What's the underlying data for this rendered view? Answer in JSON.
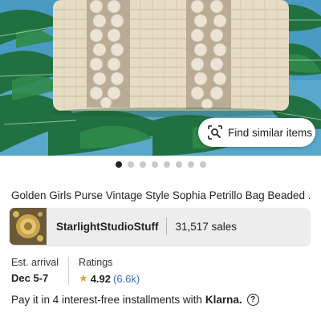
{
  "listing": {
    "image_alt": "Beaded wicker purse on palm leaf fabric",
    "find_similar_label": "Find similar items",
    "carousel_count": 8,
    "carousel_active": 1,
    "title": "Golden Girls Purse Vintage Style Sophia Petrillo Bag Beaded ..."
  },
  "shop": {
    "name": "StarlightStudioStuff",
    "sales": "31,517 sales"
  },
  "arrival": {
    "label": "Est. arrival",
    "value": "Dec 5-7"
  },
  "ratings": {
    "label": "Ratings",
    "value": "4.92",
    "count": "(6.6k)"
  },
  "payment": {
    "text": "Pay it in 4 interest-free installments with",
    "brand": "Klarna.",
    "info_icon": "?"
  },
  "icons": {
    "find_similar": "image-search-icon",
    "star": "star-icon",
    "info": "info-icon"
  },
  "colors": {
    "accent_link": "#3b6fb6",
    "star": "#e8a236"
  }
}
